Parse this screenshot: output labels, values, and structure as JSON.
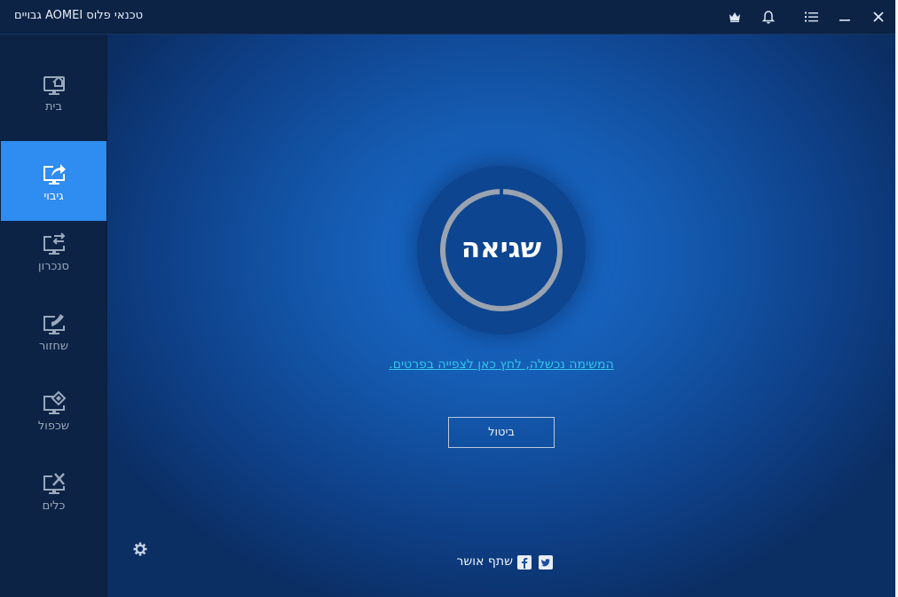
{
  "window": {
    "title": "טכנאי פלוס AOMEI גבויים"
  },
  "titlebar": {
    "icons": [
      "crown-icon",
      "bell-icon",
      "menu-icon",
      "minimize-icon",
      "close-icon"
    ]
  },
  "sidebar": {
    "items": [
      {
        "label": "בית",
        "icon": "home-monitor-icon",
        "active": false
      },
      {
        "label": "גיבוי",
        "icon": "backup-monitor-icon",
        "active": true
      },
      {
        "label": "סנכרון",
        "icon": "sync-monitor-icon",
        "active": false
      },
      {
        "label": "שחזור",
        "icon": "restore-monitor-icon",
        "active": false
      },
      {
        "label": "שכפול",
        "icon": "clone-monitor-icon",
        "active": false
      },
      {
        "label": "כלים",
        "icon": "tools-monitor-icon",
        "active": false
      }
    ],
    "settings_icon": "gear-icon"
  },
  "main": {
    "status": "שגיאה",
    "progress_fraction": 0.99,
    "fail_link": "המשימה נכשלה, לחץ כאן לצפייה בפרטים.",
    "cancel_label": "ביטול",
    "share_label": "שתף אושר",
    "social": [
      "facebook-icon",
      "twitter-icon"
    ]
  },
  "colors": {
    "accent": "#2f8cf0",
    "link": "#33c6ea",
    "ring": "#9aa3b0",
    "sidebar_bg": "#0c2346"
  }
}
